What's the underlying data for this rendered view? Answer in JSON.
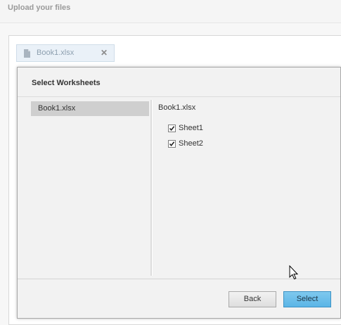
{
  "page": {
    "title": "Upload your files"
  },
  "uploaded_files": [
    {
      "name": "Book1.xlsx",
      "icon": "document-icon",
      "remove_icon": "close-icon"
    }
  ],
  "dialog": {
    "title": "Select Worksheets",
    "workbooks": [
      {
        "name": "Book1.xlsx",
        "selected": true
      }
    ],
    "selected_workbook": "Book1.xlsx",
    "sheets": [
      {
        "name": "Sheet1",
        "checked": true
      },
      {
        "name": "Sheet2",
        "checked": true
      }
    ],
    "buttons": {
      "back_label": "Back",
      "select_label": "Select"
    }
  },
  "colors": {
    "select_button": "#6bbfea",
    "workbook_selected": "#cfcfcf",
    "chip_background": "#eaf1f8"
  }
}
